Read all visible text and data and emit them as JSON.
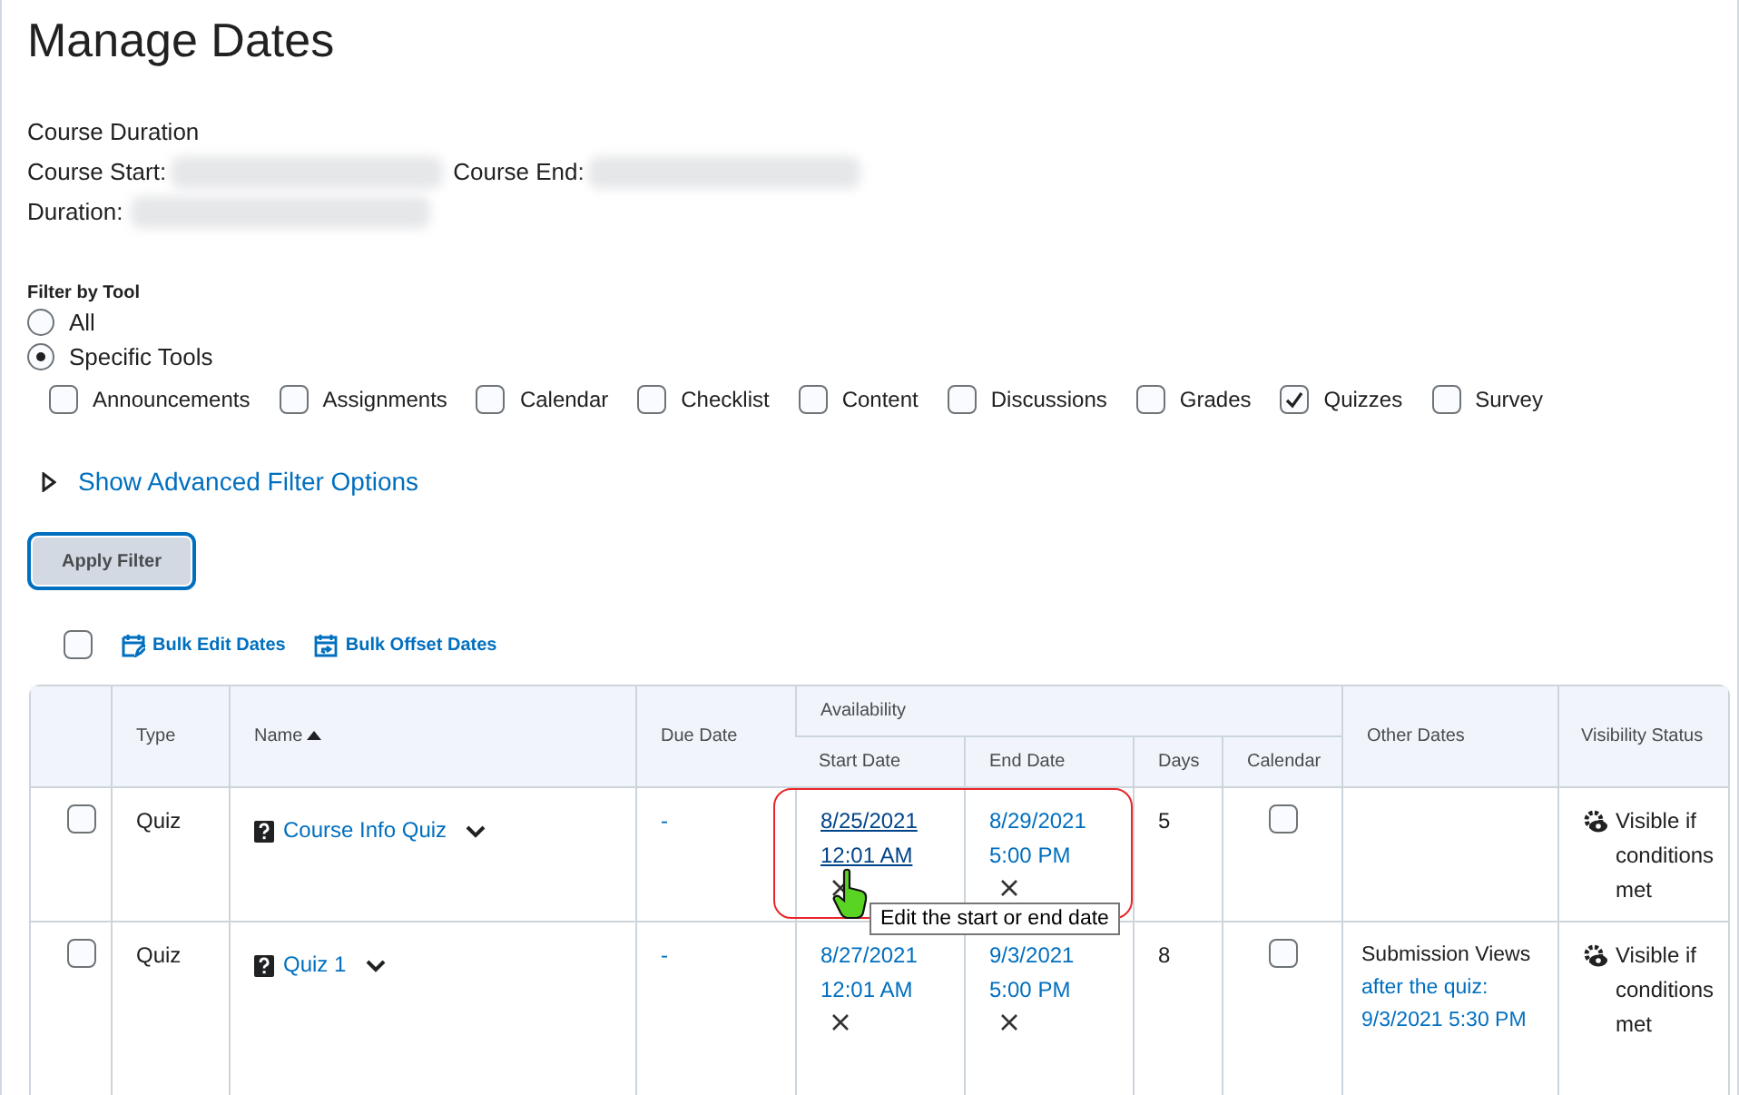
{
  "title": "Manage Dates",
  "course_duration": {
    "heading": "Course Duration",
    "start_label": "Course Start:",
    "end_label": "Course End:",
    "duration_label": "Duration:"
  },
  "filter": {
    "label": "Filter by Tool",
    "options": [
      {
        "label": "All",
        "selected": false
      },
      {
        "label": "Specific Tools",
        "selected": true
      }
    ],
    "tools": [
      {
        "label": "Announcements",
        "checked": false
      },
      {
        "label": "Assignments",
        "checked": false
      },
      {
        "label": "Calendar",
        "checked": false
      },
      {
        "label": "Checklist",
        "checked": false
      },
      {
        "label": "Content",
        "checked": false
      },
      {
        "label": "Discussions",
        "checked": false
      },
      {
        "label": "Grades",
        "checked": false
      },
      {
        "label": "Quizzes",
        "checked": true
      },
      {
        "label": "Survey",
        "checked": false
      }
    ]
  },
  "advanced_link": "Show Advanced Filter Options",
  "apply_button": "Apply Filter",
  "bulk": {
    "select_all_checked": false,
    "actions": [
      {
        "kind": "edit",
        "label": "Bulk Edit Dates"
      },
      {
        "kind": "offset",
        "label": "Bulk Offset Dates"
      }
    ]
  },
  "table": {
    "columns": {
      "type": "Type",
      "name": "Name",
      "due": "Due Date",
      "availability": "Availability",
      "start": "Start Date",
      "end": "End Date",
      "days": "Days",
      "calendar": "Calendar",
      "other": "Other Dates",
      "visibility": "Visibility Status"
    },
    "rows": [
      {
        "checked": false,
        "type": "Quiz",
        "name": "Course Info Quiz",
        "due": "-",
        "start_date": "8/25/2021",
        "start_time": "12:01 AM",
        "start_hovered": true,
        "end_date": "8/29/2021",
        "end_time": "5:00 PM",
        "days": "5",
        "calendar_checked": false,
        "visibility": "Visible if conditions met"
      },
      {
        "checked": false,
        "type": "Quiz",
        "name": "Quiz 1",
        "due": "-",
        "start_date": "8/27/2021",
        "start_time": "12:01 AM",
        "start_hovered": false,
        "end_date": "9/3/2021",
        "end_time": "5:00 PM",
        "days": "8",
        "calendar_checked": false,
        "other_label": "Submission Views",
        "other_link": "after the quiz: 9/3/2021 5:30 PM",
        "visibility": "Visible if conditions met"
      }
    ]
  },
  "tooltip": "Edit the start or end date"
}
